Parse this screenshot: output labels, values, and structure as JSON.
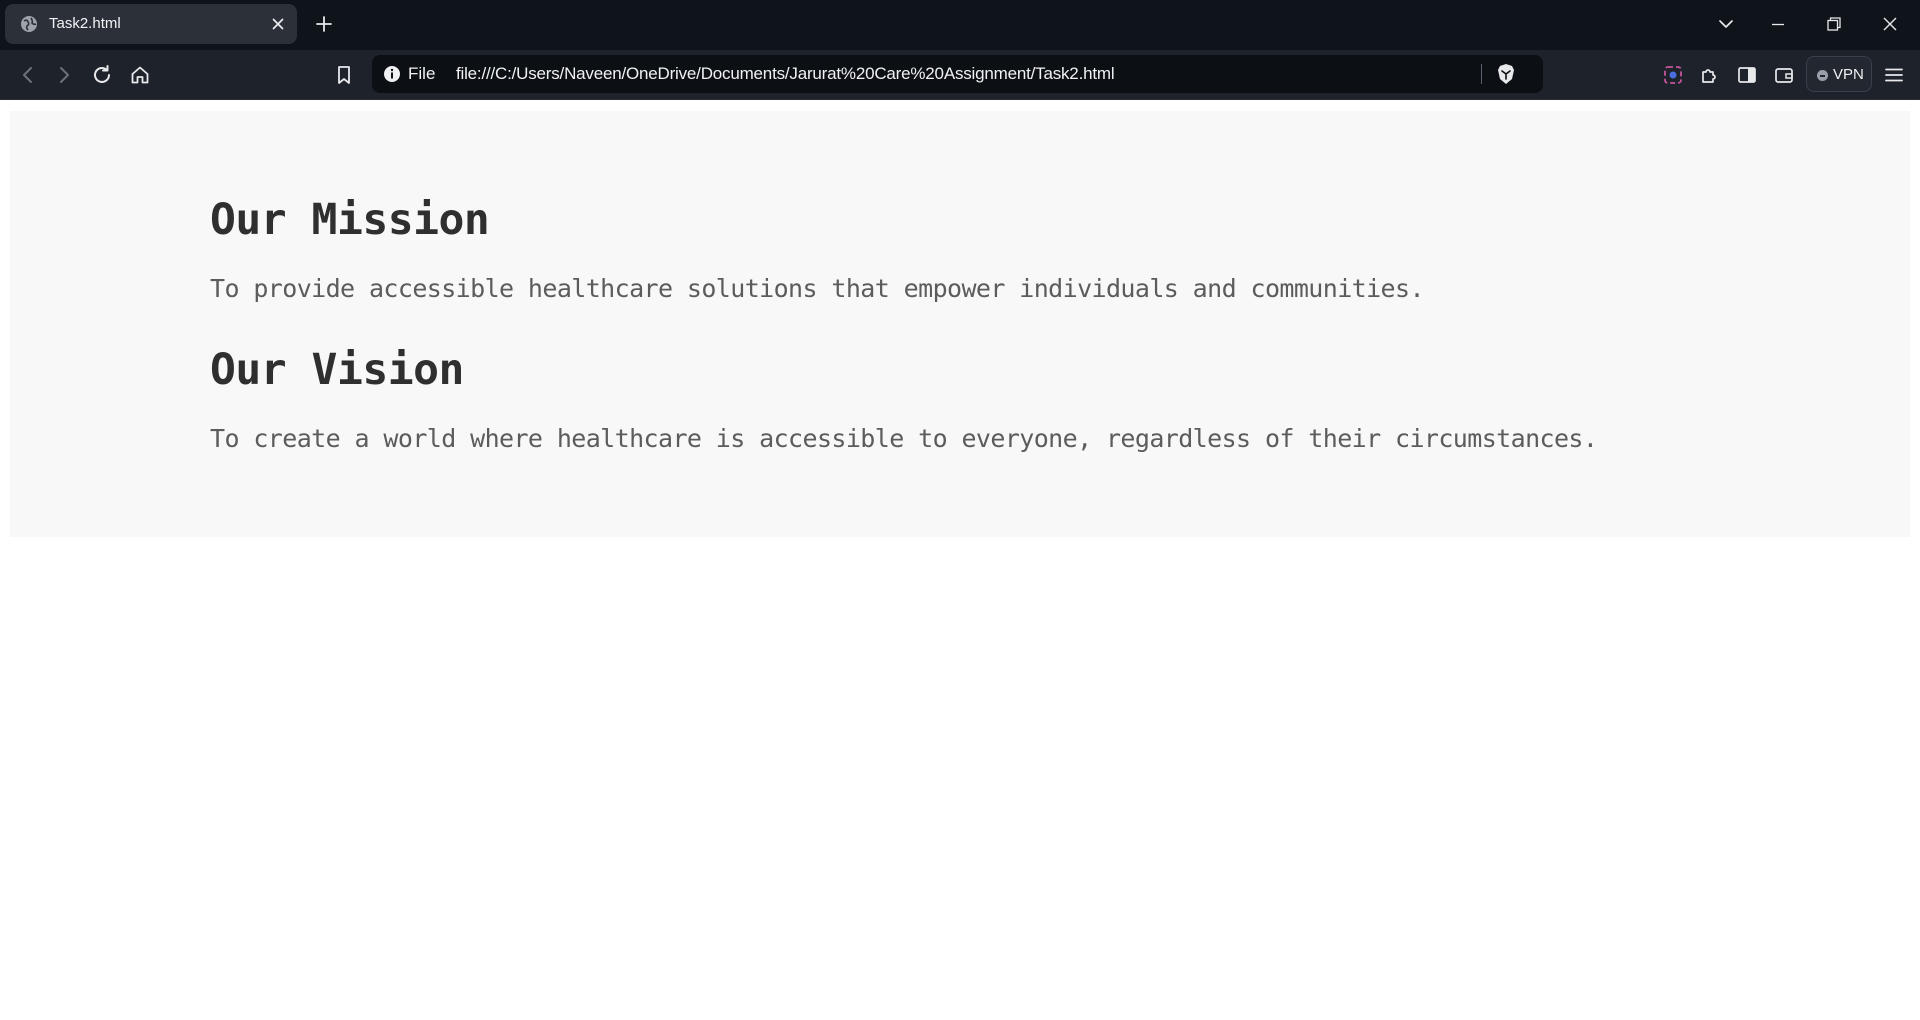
{
  "browser": {
    "tab": {
      "title": "Task2.html"
    },
    "address_bar": {
      "scheme_label": "File",
      "url": "file:///C:/Users/Naveen/OneDrive/Documents/Jarurat%20Care%20Assignment/Task2.html"
    },
    "vpn_label": "VPN"
  },
  "page": {
    "mission": {
      "heading": "Our Mission",
      "text": "To provide accessible healthcare solutions that empower individuals and communities."
    },
    "vision": {
      "heading": "Our Vision",
      "text": "To create a world where healthcare is accessible to everyone, regardless of their circumstances."
    }
  }
}
